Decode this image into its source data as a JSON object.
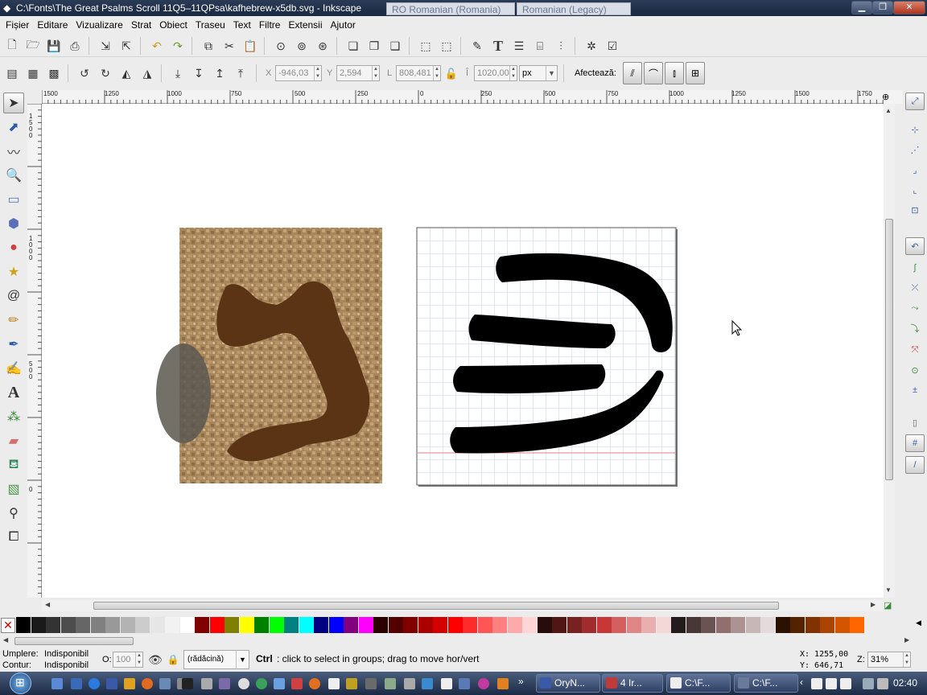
{
  "window": {
    "title": "C:\\Fonts\\The Great Psalms Scroll 11Q5–11QPsa\\kafhebrew-x5db.svg - Inkscape",
    "ime_language": "RO Romanian (Romania)",
    "ime_keyboard": "Romanian (Legacy)"
  },
  "menu": [
    {
      "label": "Fișier"
    },
    {
      "label": "Editare"
    },
    {
      "label": "Vizualizare"
    },
    {
      "label": "Strat"
    },
    {
      "label": "Obiect"
    },
    {
      "label": "Traseu"
    },
    {
      "label": "Text"
    },
    {
      "label": "Filtre"
    },
    {
      "label": "Extensii"
    },
    {
      "label": "Ajutor"
    }
  ],
  "controls": {
    "x_label": "X",
    "x_value": "-946,03",
    "y_label": "Y",
    "y_value": "2,594",
    "w_label": "L",
    "w_value": "808,481",
    "h_label": "Î",
    "h_value": "1020,00",
    "unit": "px",
    "affect_label": "Afectează:"
  },
  "hruler_labels": [
    "1500",
    "1250",
    "1000",
    "750",
    "500",
    "250",
    "0",
    "250",
    "500",
    "750",
    "1000",
    "1250",
    "1500",
    "1750"
  ],
  "vruler_labels": [
    "1500",
    "1000",
    "500",
    "0"
  ],
  "status": {
    "fill_label": "Umplere:",
    "fill_value": "Indisponibil",
    "stroke_label": "Contur:",
    "stroke_value": "Indisponibil",
    "opacity_label": "O:",
    "opacity_value": "100",
    "layer": "(rădăcină)",
    "message_key": "Ctrl",
    "message": ": click to select in groups; drag to move hor/vert",
    "cursor_x": "X: 1255,00",
    "cursor_y": "Y:  646,71",
    "zoom_label": "Z:",
    "zoom_value": "31%"
  },
  "taskbar": {
    "tasks": [
      {
        "label": "OryN..."
      },
      {
        "label": "4 Ir..."
      },
      {
        "label": "C:\\F..."
      },
      {
        "label": "C:\\F..."
      }
    ],
    "clock": "02:40"
  },
  "palette_colors": [
    "#000000",
    "#1a1a1a",
    "#333333",
    "#4d4d4d",
    "#666666",
    "#808080",
    "#999999",
    "#b3b3b3",
    "#cccccc",
    "#e6e6e6",
    "#f2f2f2",
    "#ffffff",
    "#800000",
    "#ff0000",
    "#808000",
    "#ffff00",
    "#008000",
    "#00ff00",
    "#008080",
    "#00ffff",
    "#000080",
    "#0000ff",
    "#800080",
    "#ff00ff",
    "#2b0000",
    "#550000",
    "#800000",
    "#aa0000",
    "#d40000",
    "#ff0000",
    "#ff2a2a",
    "#ff5555",
    "#ff8080",
    "#ffaaaa",
    "#ffd5d5",
    "#280b0b",
    "#501616",
    "#782121",
    "#a02c2c",
    "#c83737",
    "#d35f5f",
    "#de8787",
    "#e9afaf",
    "#f4d7d7",
    "#241c1c",
    "#483737",
    "#6c5353",
    "#916f6f",
    "#ac9393",
    "#c8b7b7",
    "#e3dbdb",
    "#2b1100",
    "#552200",
    "#803300",
    "#aa4400",
    "#d45500",
    "#ff6600"
  ]
}
